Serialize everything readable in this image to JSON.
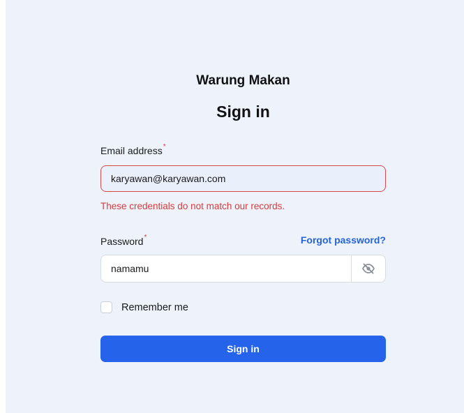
{
  "brand": "Warung Makan",
  "heading": "Sign in",
  "email": {
    "label": "Email address",
    "required_mark": "*",
    "value": "karyawan@karyawan.com",
    "error": "These credentials do not match our records."
  },
  "password": {
    "label": "Password",
    "required_mark": "*",
    "value": "namamu",
    "forgot_label": "Forgot password?",
    "toggle_icon": "eye-slash-icon"
  },
  "remember": {
    "label": "Remember me",
    "checked": false
  },
  "submit_label": "Sign in",
  "colors": {
    "background": "#eef3fb",
    "primary": "#2563eb",
    "link": "#2563d8",
    "error": "#d93b3b"
  }
}
